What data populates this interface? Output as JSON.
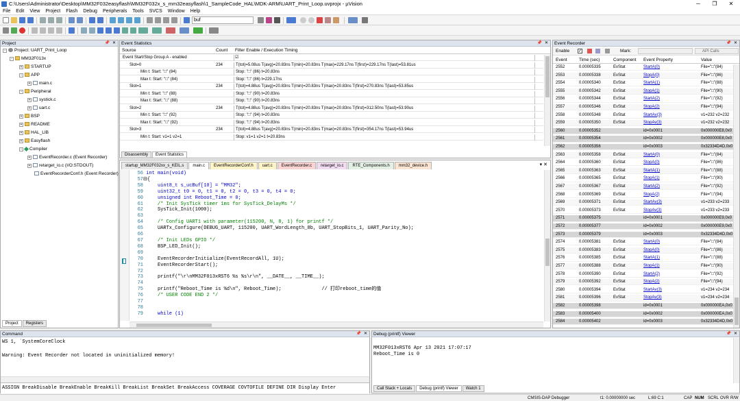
{
  "window": {
    "title": "C:\\Users\\Administrator\\Desktop\\MM32F032easyflash\\MM32F032x_s_mm32easyflash\\1_SampleCode_HAL\\MDK-ARM\\UART_Print_Loop.uvprojx - µVision"
  },
  "menu": [
    "File",
    "Edit",
    "View",
    "Project",
    "Flash",
    "Debug",
    "Peripherals",
    "Tools",
    "SVCS",
    "Window",
    "Help"
  ],
  "toolbar": {
    "find_value": "buf"
  },
  "project": {
    "title": "Project",
    "root": "Project: UART_Print_Loop",
    "target": "MM32F013x",
    "startup": "STARTUP",
    "app": "APP",
    "main": "main.c",
    "peripheral": "Peripheral",
    "systick": "systick.c",
    "uart": "uart.c",
    "bsp": "BSP",
    "readme": "README",
    "hal_lib": "HAL_LIB",
    "easyflash": "Easyflash",
    "compiler": "Compiler",
    "ev_rec_c": "EventRecorder.c (Event Recorder)",
    "retarget": "retarget_io.c (I/O:STDOUT)",
    "ev_conf": "EventRecorderConf.h (Event Recorder)",
    "tab_project": "Project",
    "tab_registers": "Registers"
  },
  "event_stats": {
    "title": "Event Statistics",
    "col_source": "Source",
    "col_count": "Count",
    "col_filter": "Filter Enable / Execution Timing",
    "rows": [
      {
        "src": "Event Start/Stop Group A - enabled",
        "count": "",
        "info": ""
      },
      {
        "src": "Slot=0",
        "count": "234",
        "info": "T(tot)=5.08us T(avg)=20.83ns T(min)=20.83ns T(max)=229.17ns T(first)=229.17ns T(last)=53.81us"
      },
      {
        "src": "Min t: Start: \"□\" (84)",
        "count": "",
        "info": "Stop: \"□\" (86) t=20.83ns"
      },
      {
        "src": "Max t: Start: \"□\" (84)",
        "count": "",
        "info": "Stop: \"□\" (86) t=229.17ns"
      },
      {
        "src": "Slot=1",
        "count": "234",
        "info": "T(tot)=4.88us T(avg)=20.83ns T(min)=20.83ns T(max)=20.83ns T(first)=270.83ns T(last)=53.85us"
      },
      {
        "src": "Min t: Start: \"□\" (88)",
        "count": "",
        "info": "Stop: \"□\" (90) t=20.83ns"
      },
      {
        "src": "Max t: Start: \"□\" (88)",
        "count": "",
        "info": "Stop: \"□\" (90) t=20.83ns"
      },
      {
        "src": "Slot=2",
        "count": "234",
        "info": "T(tot)=4.88us T(avg)=20.83ns T(min)=20.83ns T(max)=20.83ns T(first)=312.50ns T(last)=53.90us"
      },
      {
        "src": "Min t: Start: \"□\" (92)",
        "count": "",
        "info": "Stop: \"□\" (94) t=20.83ns"
      },
      {
        "src": "Max t: Start: \"□\" (92)",
        "count": "",
        "info": "Stop: \"□\" (94) t=20.83ns"
      },
      {
        "src": "Slot=3",
        "count": "234",
        "info": "T(tot)=4.88us T(avg)=20.83ns T(min)=20.83ns T(max)=20.83ns T(first)=354.17ns T(last)=53.94us"
      },
      {
        "src": "Min t: Start: v1=1 v2=1",
        "count": "",
        "info": "Stop: v1=1 v2=1 t=20.83ns"
      }
    ],
    "tab_disasm": "Disassembly",
    "tab_stats": "Event Statistics"
  },
  "editor": {
    "tabs": [
      "startup_MM32F032xx_s_KEIL.s",
      "main.c",
      "EventRecorderConf.h",
      "uart.c",
      "EventRecorder.c",
      "retarget_io.c",
      "RTE_Components.h",
      "mm32_device.h"
    ],
    "lines": [
      {
        "n": "56",
        "t": "int main(void)"
      },
      {
        "n": "57",
        "t": "{"
      },
      {
        "n": "58",
        "t": "    uint8_t s_ucBuf[10] = \"MM32\";"
      },
      {
        "n": "59",
        "t": "    uint32_t t0 = 0, t1 = 0, t2 = 0, t3 = 0, t4 = 0;"
      },
      {
        "n": "60",
        "t": "    unsigned int Reboot_Time = 0;"
      },
      {
        "n": "61",
        "t": "    /* Init SysTick timer 1ms for SysTick_DelayMs */"
      },
      {
        "n": "62",
        "t": "    SysTick_Init(1000);"
      },
      {
        "n": "63",
        "t": ""
      },
      {
        "n": "64",
        "t": "    /* Config UART1 with parameter(115200, N, 8, 1) for printf */"
      },
      {
        "n": "65",
        "t": "    UARTx_Configure(DEBUG_UART, 115200, UART_WordLength_8b, UART_StopBits_1, UART_Parity_No);"
      },
      {
        "n": "66",
        "t": ""
      },
      {
        "n": "67",
        "t": "    /* Init LEDs GPIO */"
      },
      {
        "n": "68",
        "t": "    BSP_LED_Init();"
      },
      {
        "n": "69",
        "t": ""
      },
      {
        "n": "70",
        "t": "    EventRecorderInitialize(EventRecordAll, 1U);"
      },
      {
        "n": "71",
        "t": "    EventRecorderStart();"
      },
      {
        "n": "72",
        "t": ""
      },
      {
        "n": "73",
        "t": "    printf(\"\\r\\nMM32F013xRST6 %s %s\\r\\n\", __DATE__, __TIME__);"
      },
      {
        "n": "74",
        "t": ""
      },
      {
        "n": "75",
        "t": "    printf(\"Reboot_Time is %d\\n\", Reboot_Time);              // 打印reboot_time的值"
      },
      {
        "n": "76",
        "t": "    /* USER CODE END 2 */"
      },
      {
        "n": "77",
        "t": ""
      },
      {
        "n": "78",
        "t": ""
      },
      {
        "n": "79",
        "t": "    while (1)"
      }
    ]
  },
  "event_recorder": {
    "title": "Event Recorder",
    "enable_label": "Enable",
    "mark_label": "Mark:",
    "api_calls": "API Calls",
    "columns": [
      "Event",
      "Time (sec)",
      "Component",
      "Event Property",
      "Value"
    ],
    "rows": [
      [
        "2552",
        "0.00005335",
        "EvStat",
        "StartA(0)",
        "File=\"□\"(84)"
      ],
      [
        "2553",
        "0.00005338",
        "EvStat",
        "StopA(0)",
        "File=\"□\"(86)"
      ],
      [
        "2554",
        "0.00005340",
        "EvStat",
        "StartA(1)",
        "File=\"□\"(88)"
      ],
      [
        "2555",
        "0.00005342",
        "EvStat",
        "StopA(1)",
        "File=\"□\"(90)"
      ],
      [
        "2556",
        "0.00005344",
        "EvStat",
        "StartA(2)",
        "File=\"□\"(92)"
      ],
      [
        "2557",
        "0.00005346",
        "EvStat",
        "StopA(2)",
        "File=\"□\"(94)"
      ],
      [
        "2558",
        "0.00005348",
        "EvStat",
        "StartAv(3)",
        "v1=232 v2=232"
      ],
      [
        "2559",
        "0.00005350",
        "EvStat",
        "StopAv(3)",
        "v1=232 v2=232"
      ],
      [
        "2560",
        "0.00005352",
        "",
        "id=0x0001",
        "0x000000E8,0x0"
      ],
      [
        "2561",
        "0.00005354",
        "",
        "id=0x0002",
        "0x000000E8,0x0"
      ],
      [
        "2562",
        "0.00005356",
        "",
        "id=0x0003",
        "0x32334D4D,0x0"
      ],
      [
        "2563",
        "0.00005358",
        "EvStat",
        "StartA(0)",
        "File=\"□\"(84)"
      ],
      [
        "2564",
        "0.00005360",
        "EvStat",
        "StopA(0)",
        "File=\"□\"(86)"
      ],
      [
        "2565",
        "0.00005363",
        "EvStat",
        "StartA(1)",
        "File=\"□\"(88)"
      ],
      [
        "2566",
        "0.00005365",
        "EvStat",
        "StopA(1)",
        "File=\"□\"(90)"
      ],
      [
        "2567",
        "0.00005367",
        "EvStat",
        "StartA(2)",
        "File=\"□\"(92)"
      ],
      [
        "2568",
        "0.00005369",
        "EvStat",
        "StopA(2)",
        "File=\"□\"(94)"
      ],
      [
        "2569",
        "0.00005371",
        "EvStat",
        "StartAv(3)",
        "v1=233 v2=233"
      ],
      [
        "2570",
        "0.00005373",
        "EvStat",
        "StopAv(3)",
        "v1=233 v2=233"
      ],
      [
        "2571",
        "0.00005375",
        "",
        "id=0x0001",
        "0x000000E9,0x0"
      ],
      [
        "2572",
        "0.00005377",
        "",
        "id=0x0002",
        "0x000000E9,0x0"
      ],
      [
        "2573",
        "0.00005379",
        "",
        "id=0x0003",
        "0x32334D4D,0x0"
      ],
      [
        "2574",
        "0.00005381",
        "EvStat",
        "StartA(0)",
        "File=\"□\"(84)"
      ],
      [
        "2575",
        "0.00005383",
        "EvStat",
        "StopA(0)",
        "File=\"□\"(86)"
      ],
      [
        "2576",
        "0.00005385",
        "EvStat",
        "StartA(1)",
        "File=\"□\"(88)"
      ],
      [
        "2577",
        "0.00005388",
        "EvStat",
        "StopA(1)",
        "File=\"□\"(90)"
      ],
      [
        "2578",
        "0.00005390",
        "EvStat",
        "StartA(2)",
        "File=\"□\"(92)"
      ],
      [
        "2579",
        "0.00005392",
        "EvStat",
        "StopA(2)",
        "File=\"□\"(94)"
      ],
      [
        "2580",
        "0.00005394",
        "EvStat",
        "StartAv(3)",
        "v1=234 v2=234"
      ],
      [
        "2581",
        "0.00005396",
        "EvStat",
        "StopAv(3)",
        "v1=234 v2=234"
      ],
      [
        "2582",
        "0.00005398",
        "",
        "id=0x0001",
        "0x000000EA,0x0"
      ],
      [
        "2583",
        "0.00005400",
        "",
        "id=0x0002",
        "0x000000EA,0x0"
      ],
      [
        "2584",
        "0.00005402",
        "",
        "id=0x0003",
        "0x32334D4D,0x0"
      ]
    ]
  },
  "command": {
    "title": "Command",
    "lines": [
      "WS 1, `SystemCoreClock",
      "",
      "Warning: Event Recorder not located in uninitialized memory!"
    ],
    "hint": "ASSIGN BreakDisable BreakEnable BreakKill BreakList BreakSet BreakAccess COVERAGE COVTOFILE DEFINE DIR Display Enter"
  },
  "debug": {
    "title": "Debug (printf) Viewer",
    "lines": [
      "",
      "MM32F013xRST6 Apr 13 2021 17:07:17",
      "Reboot_Time is 0"
    ],
    "tabs": [
      "Call Stack + Locals",
      "Debug (printf) Viewer",
      "Watch 1"
    ]
  },
  "status": {
    "debugger": "CMSIS-DAP Debugger",
    "time": "t1: 0.00000000 sec",
    "pos": "L:69 C:1",
    "caps": "CAP",
    "num": "NUM",
    "scrl": "SCRL",
    "ovr": "OVR",
    "rw": "R/W"
  }
}
